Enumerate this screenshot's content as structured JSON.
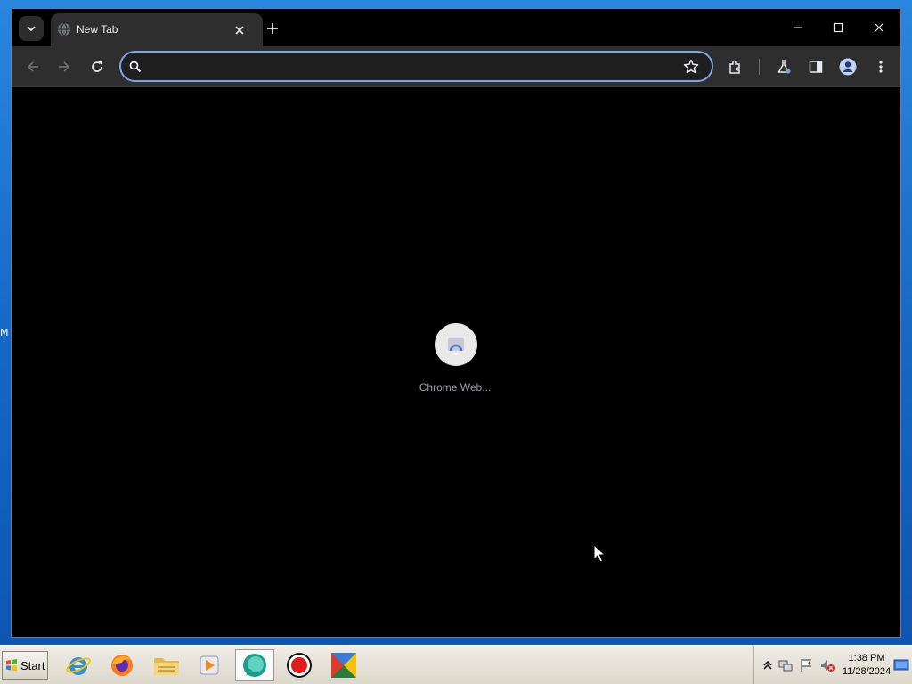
{
  "desktop": {
    "edge_label": "M"
  },
  "browser": {
    "tab": {
      "title": "New Tab",
      "favicon": "globe-icon"
    },
    "omnibox": {
      "value": "",
      "placeholder": ""
    },
    "toolbar_icons": [
      "back-arrow-icon",
      "forward-arrow-icon",
      "reload-icon",
      "search-icon",
      "star-icon",
      "extensions-icon",
      "labs-icon",
      "side-panel-icon",
      "profile-icon",
      "menu-icon"
    ],
    "window_controls": [
      "minimize-icon",
      "maximize-icon",
      "close-icon"
    ],
    "new_tab_page": {
      "shortcuts": [
        {
          "label": "Chrome Web..."
        }
      ]
    }
  },
  "taskbar": {
    "start_label": "Start",
    "apps": [
      "internet-explorer-icon",
      "firefox-icon",
      "file-explorer-icon",
      "media-player-icon",
      "chrome-icon",
      "record-icon",
      "app-icon"
    ],
    "tray": {
      "time": "1:38 PM",
      "date": "11/28/2024"
    }
  },
  "colors": {
    "omnibox_border": "#7aa5e8",
    "tab_bg": "#2e2e2e",
    "content_bg": "#000000"
  }
}
